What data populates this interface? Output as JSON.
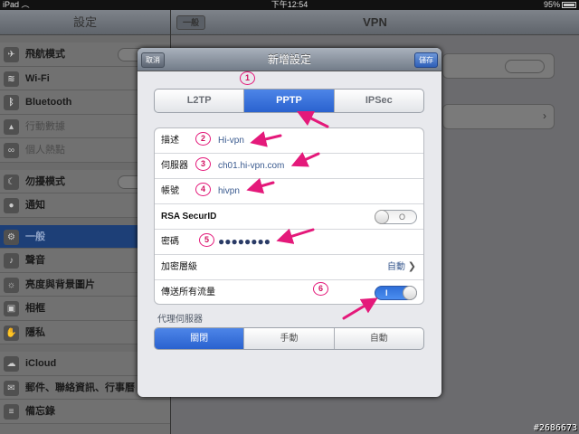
{
  "status_bar": {
    "device": "iPad",
    "wifi_icon": "wifi-icon",
    "time": "下午12:54",
    "battery": "95%"
  },
  "settings_sidebar": {
    "title": "設定",
    "items": [
      {
        "label": "飛航模式",
        "icon": "airplane-icon",
        "dim": false
      },
      {
        "label": "Wi-Fi",
        "icon": "wifi-icon",
        "dim": false
      },
      {
        "label": "Bluetooth",
        "icon": "bluetooth-icon",
        "dim": false
      },
      {
        "label": "行動數據",
        "icon": "cellular-icon",
        "dim": true
      },
      {
        "label": "個人熱點",
        "icon": "hotspot-icon",
        "dim": true
      },
      {
        "label": "勿擾模式",
        "icon": "moon-icon",
        "dim": false
      },
      {
        "label": "通知",
        "icon": "notification-icon",
        "dim": false
      },
      {
        "label": "一般",
        "icon": "gear-icon",
        "dim": false
      },
      {
        "label": "聲音",
        "icon": "speaker-icon",
        "dim": false
      },
      {
        "label": "亮度與背景圖片",
        "icon": "brightness-icon",
        "dim": false
      },
      {
        "label": "相框",
        "icon": "picture-frame-icon",
        "dim": false
      },
      {
        "label": "隱私",
        "icon": "privacy-hand-icon",
        "dim": false
      },
      {
        "label": "iCloud",
        "icon": "cloud-icon",
        "dim": false
      },
      {
        "label": "郵件、聯絡資訊、行事曆",
        "icon": "mail-icon",
        "dim": false
      },
      {
        "label": "備忘錄",
        "icon": "notes-icon",
        "dim": false
      }
    ]
  },
  "vpn_pane": {
    "title": "VPN",
    "back_label": "一般"
  },
  "modal": {
    "title": "新增設定",
    "cancel_label": "取消",
    "save_label": "儲存",
    "vpn_types": [
      "L2TP",
      "PPTP",
      "IPSec"
    ],
    "selected_type": "PPTP",
    "fields": {
      "description_label": "描述",
      "description_value": "Hi-vpn",
      "server_label": "伺服器",
      "server_value": "ch01.hi-vpn.com",
      "account_label": "帳號",
      "account_value": "hivpn",
      "rsa_label": "RSA SecurID",
      "rsa_on": false,
      "rsa_mark": "O",
      "password_label": "密碼",
      "password_value": "●●●●●●●●",
      "encryption_label": "加密層級",
      "encryption_value": "自動",
      "send_all_label": "傳送所有流量",
      "send_all_on": true,
      "send_all_mark": "I"
    },
    "proxy": {
      "title": "代理伺服器",
      "options": [
        "關閉",
        "手動",
        "自動"
      ],
      "selected": "關閉"
    }
  },
  "annotations": {
    "markers": [
      "1",
      "2",
      "3",
      "4",
      "5",
      "6"
    ],
    "color": "#e4197a"
  },
  "watermark": "#2686673"
}
